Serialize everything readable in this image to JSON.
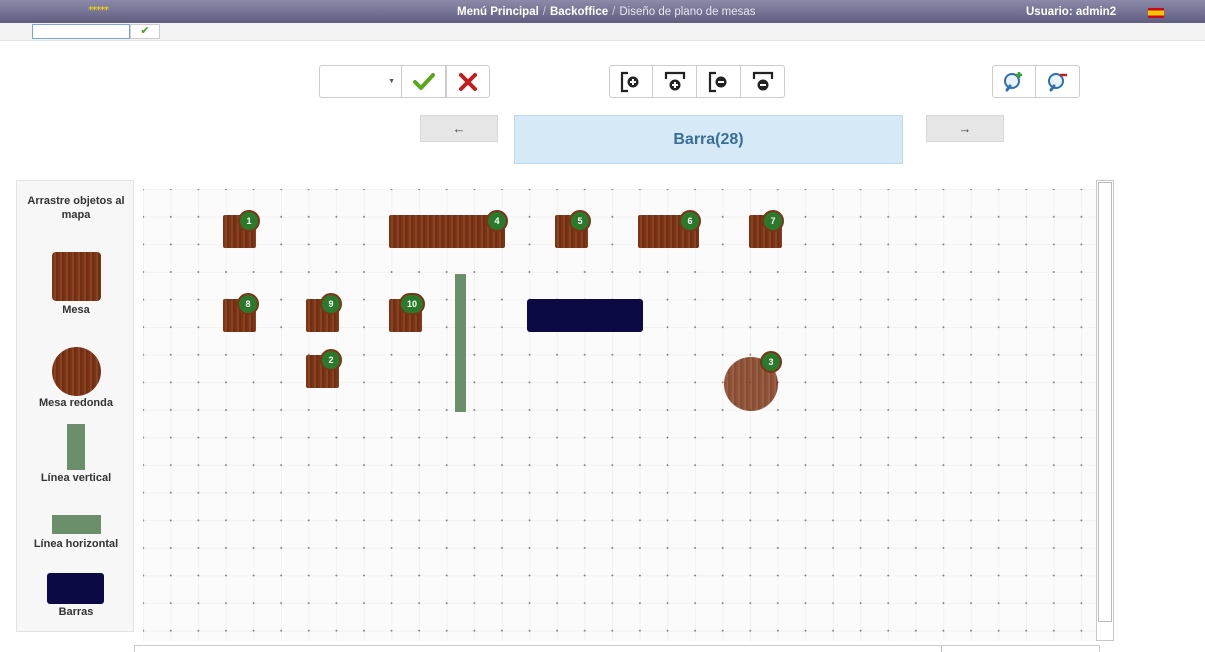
{
  "topbar": {
    "stars": "*****",
    "breadcrumb": {
      "item1": "Menú Principal",
      "item2": "Backoffice",
      "current": "Diseño de plano de mesas",
      "sep": "/"
    },
    "user": "Usuario: admin2",
    "language_flag": "es-flag"
  },
  "strip": {
    "input_value": "",
    "ok_icon": "check-icon"
  },
  "toolbar": {
    "select_value": "",
    "confirm_icon": "check-icon",
    "cancel_icon": "x-icon",
    "layout_buttons": [
      "add-column-icon",
      "add-row-icon",
      "remove-column-icon",
      "remove-row-icon"
    ],
    "zoom_buttons": [
      "zoom-in-icon",
      "zoom-out-icon"
    ]
  },
  "nav": {
    "prev_label": "←",
    "next_label": "→",
    "zone_title": "Barra(28)"
  },
  "palette": {
    "title": "Arrastre objetos al mapa",
    "items": [
      {
        "label": "Mesa"
      },
      {
        "label": "Mesa redonda"
      },
      {
        "label": "Línea vertical"
      },
      {
        "label": "Línea horizontal"
      },
      {
        "label": "Barras"
      }
    ]
  },
  "map": {
    "tables": [
      {
        "number": "1",
        "shape": "square"
      },
      {
        "number": "4",
        "shape": "rect"
      },
      {
        "number": "5",
        "shape": "square"
      },
      {
        "number": "6",
        "shape": "rect"
      },
      {
        "number": "7",
        "shape": "square"
      },
      {
        "number": "8",
        "shape": "square"
      },
      {
        "number": "9",
        "shape": "square"
      },
      {
        "number": "10",
        "shape": "square"
      },
      {
        "number": "2",
        "shape": "square"
      },
      {
        "number": "3",
        "shape": "round"
      }
    ],
    "colors": {
      "wood": "#7a3517",
      "badge": "#2b7a2b",
      "bar": "#0c0a45",
      "line": "#6b8f6b"
    }
  }
}
